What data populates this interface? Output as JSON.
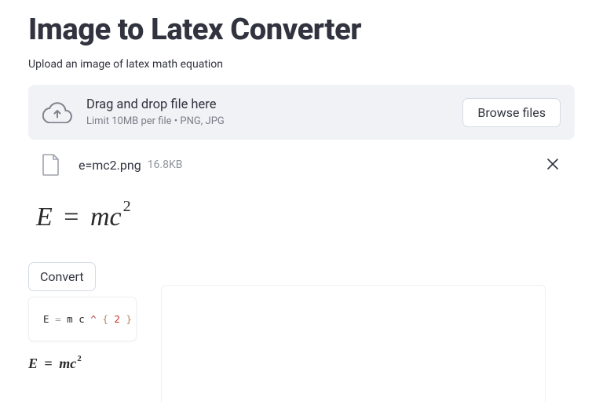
{
  "header": {
    "title": "Image to Latex Converter",
    "subtitle": "Upload an image of latex math equation"
  },
  "uploader": {
    "title": "Drag and drop file here",
    "hint": "Limit 10MB per file • PNG, JPG",
    "browse_label": "Browse files"
  },
  "file": {
    "name": "e=mc2.png",
    "size": "16.8KB"
  },
  "preview": {
    "E": "E",
    "eq": "=",
    "m": "m",
    "c": "c",
    "exp": "2"
  },
  "actions": {
    "convert_label": "Convert"
  },
  "code": {
    "t1": "E",
    "t2": "=",
    "t3": "m",
    "t4": "c",
    "t5": "^",
    "t6": "{",
    "t7": "2",
    "t8": "}"
  },
  "result": {
    "E": "E",
    "eq": "=",
    "m": "m",
    "c": "c",
    "exp": "2"
  }
}
